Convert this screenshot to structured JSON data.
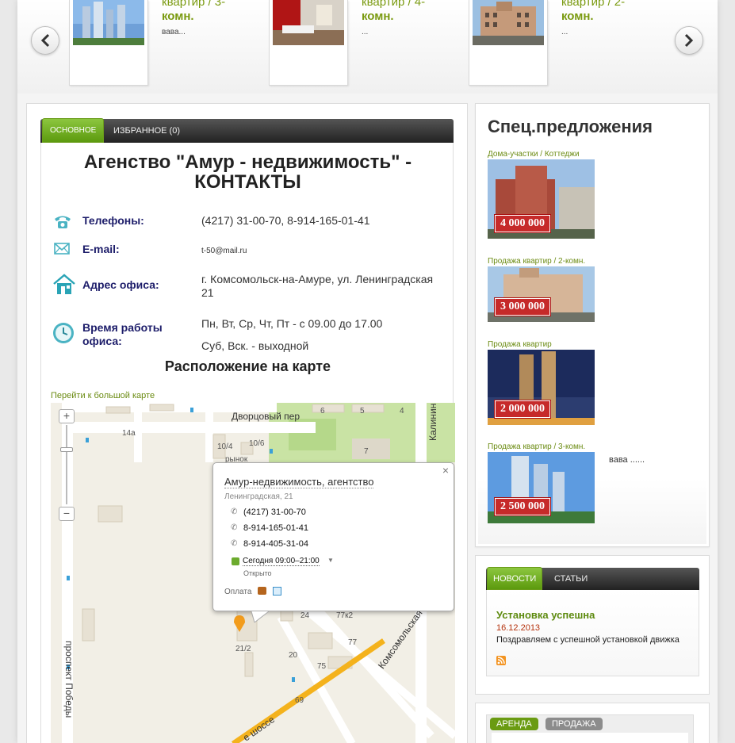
{
  "slider": {
    "prev_label": "previous",
    "next_label": "next",
    "items": [
      {
        "title": "квартир / 3-",
        "title2": "комн.",
        "desc": "вава..."
      },
      {
        "title": "квартир / 4-",
        "title2": "комн.",
        "desc": "..."
      },
      {
        "title": "квартир / 2-",
        "title2": "комн.",
        "desc": "..."
      }
    ]
  },
  "tabs": {
    "main": "ОСНОВНОЕ",
    "favorites": "ИЗБРАННОЕ (0)"
  },
  "page_title_line1": "Агенство \"Амур - недвижимость\" -",
  "page_title_line2": "КОНТАКТЫ",
  "contacts": {
    "phones_label": "Телефоны:",
    "phones_value": "(4217) 31-00-70, 8-914-165-01-41",
    "email_label": "E-mail:",
    "email_value": "t-50@mail.ru",
    "address_label": "Адрес офиса:",
    "address_value_line1": "г. Комсомольск-на-Амуре, ул. Ленинградская",
    "address_value_line2": "21",
    "hours_label_line1": "Время работы",
    "hours_label_line2": "офиса:",
    "hours_value1": "Пн, Вт, Ср, Чт, Пт - с 09.00 до 17.00",
    "hours_value2": "Суб, Вск. - выходной"
  },
  "map": {
    "heading": "Расположение на карте",
    "big_map_link": "Перейти к большой карте",
    "streets": {
      "dvortsovy": "Дворцовый пер",
      "pobedy": "проспект Победы",
      "kalinina": "Калинина",
      "komsomolskaya": "Комсомольская",
      "shosse": "е шоссе"
    },
    "labels": {
      "n14a": "14а",
      "n6": "6",
      "n5": "5",
      "n4": "4",
      "n7": "7",
      "n10_6": "10/6",
      "n10_4": "10/4",
      "rynok": "рынок",
      "n24": "24",
      "n77k2": "77к2",
      "n77": "77",
      "n21_2": "21/2",
      "n20": "20",
      "n75": "75",
      "n69": "69"
    },
    "zoom_in": "+",
    "zoom_out": "−",
    "balloon": {
      "close": "×",
      "title": "Амур-недвижимость, агентство",
      "address": "Ленинградская, 21",
      "phones": [
        "(4217) 31-00-70",
        "8-914-165-01-41",
        "8-914-405-31-04"
      ],
      "hours": "Сегодня 09:00–21:00",
      "status": "Открыто",
      "payment": "Оплата"
    }
  },
  "specials": {
    "heading": "Спец.предложения",
    "items": [
      {
        "category": "Дома-участки / Коттеджи",
        "price": "4 000 000"
      },
      {
        "category": "Продажа квартир / 2-комн.",
        "price": "3 000 000"
      },
      {
        "category": "Продажа квартир",
        "price": "2 000 000"
      },
      {
        "category": "Продажа квартир / 3-комн.",
        "price": "2 500 000",
        "desc": "вава ......"
      }
    ]
  },
  "news": {
    "tab_news": "НОВОСТИ",
    "tab_articles": "СТАТЬИ",
    "title": "Установка успешна",
    "date": "16.12.2013",
    "text": "Поздравляем с успешной установкой движка"
  },
  "rent": {
    "tab_rent": "АРЕНДА",
    "tab_sale": "ПРОДАЖА"
  },
  "colors": {
    "accent_green": "#6a9b12",
    "price_red": "#c62a2a",
    "link_green": "#6b8b12"
  }
}
